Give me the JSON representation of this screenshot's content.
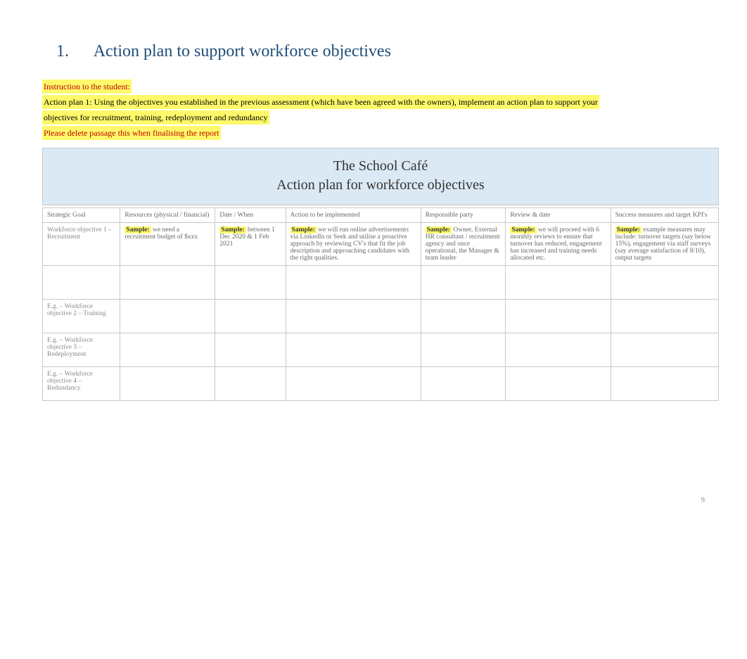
{
  "heading": {
    "number": "1.",
    "text": "Action plan to support workforce objectives"
  },
  "instructions": {
    "line1": "Instruction to the student:",
    "line2": "Action plan 1: Using the objectives you established in the previous assessment (which have been agreed with the owners), implement an action plan to support your",
    "line3": "objectives for recruitment, training, redeployment and redundancy",
    "line4": "Please delete passage this when finalising the report"
  },
  "titleBox": {
    "line1": "The School Café",
    "line2": "Action plan for workforce objectives"
  },
  "table": {
    "headers": [
      "Strategic Goal",
      "Resources (physical / financial)",
      "Date / When",
      "Action to be implemented",
      "Responsible party",
      "Review & date",
      "Success measures and target KPI's"
    ],
    "exampleRow": {
      "goal": "Workforce objective 1 - Recruitment",
      "resourcesHL": "Sample:",
      "resourcesRest": " we need a recruitment budget of $xxx",
      "dateHL": "Sample:",
      "dateRest": " between 1 Dec 2020 & 1 Feb 2021",
      "actionHL": "Sample:",
      "actionRest": " we will run online advertisements via LinkedIn or Seek and utilise a proactive approach by reviewing CV's that fit the job description and approaching candidates with the right qualities.",
      "respHL": "Sample:",
      "respRest": " Owner, External HR consultant / recruitment agency and once operational, the Manager & team leader",
      "reviewHL": "Sample:",
      "reviewRest": " we will proceed with 6 monthly reviews to ensure that turnover has reduced, engagement has increased and training needs allocated etc.",
      "successHL": "Sample:",
      "successRest": " example measures may include: turnover targets (say below 15%), engagement via staff surveys (say average satisfaction of 8/10), output targets"
    },
    "rows": [
      "",
      "E.g. – Workforce objective 2 – Training",
      "E.g. – Workforce objective 3 – Redeployment",
      "E.g. – Workforce objective 4 – Redundancy"
    ]
  },
  "pageNumber": "9"
}
